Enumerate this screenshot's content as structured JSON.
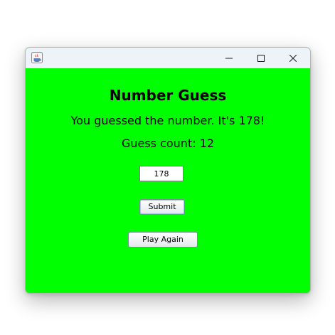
{
  "window": {
    "icon": "java-icon",
    "controls": {
      "minimize_icon": "minimize-icon",
      "maximize_icon": "maximize-icon",
      "close_icon": "close-icon"
    }
  },
  "content": {
    "title": "Number Guess",
    "message": "You guessed the number. It's 178!",
    "guess_count": "Guess count: 12",
    "guess_input_value": "178",
    "submit_label": "Submit",
    "play_again_label": "Play Again",
    "background_color": "#00ff00"
  }
}
